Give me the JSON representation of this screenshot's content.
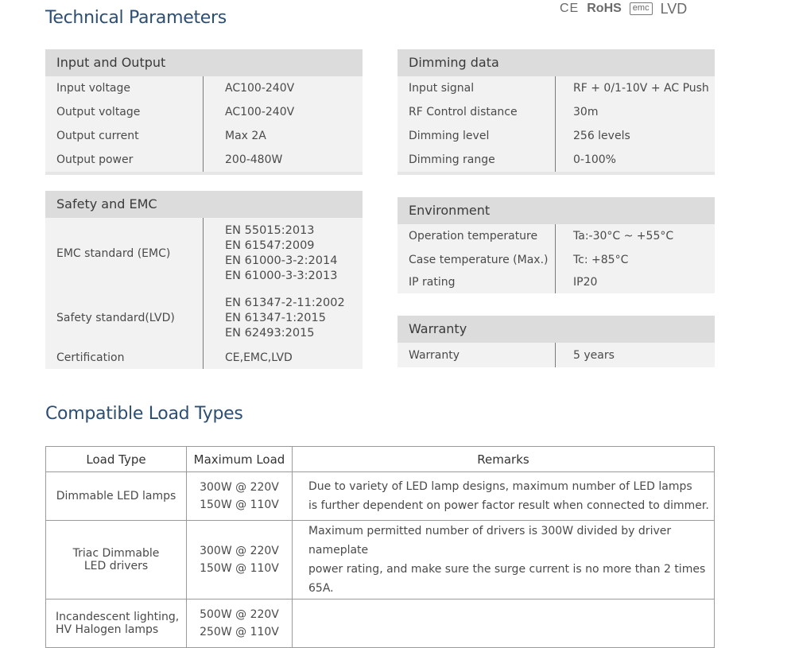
{
  "page": {
    "title": "Technical Parameters",
    "certifications": [
      "CE",
      "RoHS",
      "emc",
      "LVD"
    ],
    "load_title": "Compatible Load Types"
  },
  "input_output": {
    "header": "Input and Output",
    "rows": [
      {
        "label": "Input voltage",
        "value": "AC100-240V"
      },
      {
        "label": "Output voltage",
        "value": "AC100-240V"
      },
      {
        "label": "Output current",
        "value": "Max 2A"
      },
      {
        "label": "Output power",
        "value": "200-480W"
      }
    ]
  },
  "safety": {
    "header": "Safety and EMC",
    "emc_label": "EMC standard (EMC)",
    "emc_values": [
      "EN 55015:2013",
      "EN 61547:2009",
      "EN 61000-3-2:2014",
      "EN 61000-3-3:2013"
    ],
    "lvd_label": "Safety standard(LVD)",
    "lvd_values": [
      "EN 61347-2-11:2002",
      "EN 61347-1:2015",
      "EN 62493:2015"
    ],
    "cert_label": "Certification",
    "cert_value": "CE,EMC,LVD"
  },
  "dimming": {
    "header": "Dimming data",
    "rows": [
      {
        "label": "Input signal",
        "value": "RF + 0/1-10V + AC Push"
      },
      {
        "label": "RF Control distance",
        "value": "30m"
      },
      {
        "label": "Dimming level",
        "value": "256 levels"
      },
      {
        "label": "Dimming range",
        "value": "0-100%"
      }
    ]
  },
  "environment": {
    "header": "Environment",
    "rows": [
      {
        "label": "Operation temperature",
        "value": "Ta:-30°C ~ +55°C"
      },
      {
        "label": "Case temperature (Max.)",
        "value": "Tc: +85°C"
      },
      {
        "label": "IP rating",
        "value": "IP20"
      }
    ]
  },
  "warranty": {
    "header": "Warranty",
    "label": "Warranty",
    "value": "5 years"
  },
  "load_table": {
    "headers": [
      "Load Type",
      "Maximum Load",
      "Remarks"
    ],
    "rows": [
      {
        "type": [
          "Dimmable LED lamps"
        ],
        "max": [
          "300W @ 220V",
          "150W @ 110V"
        ],
        "remarks": [
          "Due to variety of LED lamp designs, maximum number of LED lamps",
          "is further dependent on power factor result when connected to dimmer."
        ]
      },
      {
        "type": [
          "Triac Dimmable",
          "LED drivers"
        ],
        "max": [
          "300W @ 220V",
          "150W @ 110V"
        ],
        "remarks": [
          "Maximum permitted number of drivers is 300W divided by driver nameplate",
          "power rating, and make sure the surge current is no more than 2 times 65A."
        ]
      },
      {
        "type": [
          "Incandescent lighting,",
          "HV Halogen lamps"
        ],
        "max": [
          "500W @ 220V",
          "250W @ 110V"
        ],
        "remarks": []
      }
    ]
  }
}
